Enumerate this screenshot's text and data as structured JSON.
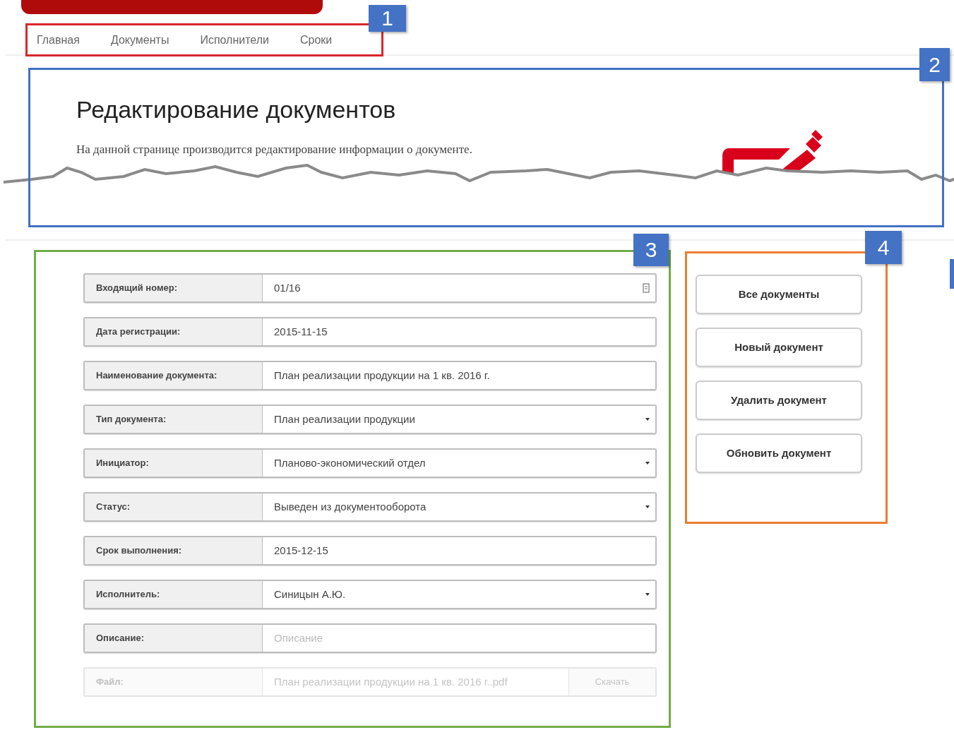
{
  "nav": {
    "badge": "1",
    "items": [
      {
        "label": "Главная"
      },
      {
        "label": "Документы"
      },
      {
        "label": "Исполнители"
      },
      {
        "label": "Сроки"
      }
    ]
  },
  "header": {
    "badge": "2",
    "title": "Редактирование документов",
    "description": "На данной странице производится редактирование информации о документе."
  },
  "form": {
    "badge": "3",
    "fields": [
      {
        "label": "Входящий номер:",
        "value": "01/16",
        "kind": "text",
        "icon": true,
        "disabled": false
      },
      {
        "label": "Дата регистрации:",
        "value": "2015-11-15",
        "kind": "text",
        "icon": false,
        "disabled": false
      },
      {
        "label": "Наименование документа:",
        "value": "План реализации продукции на 1 кв. 2016 г.",
        "kind": "text",
        "icon": false,
        "disabled": false
      },
      {
        "label": "Тип документа:",
        "value": "План реализации продукции",
        "kind": "select",
        "icon": false,
        "disabled": false
      },
      {
        "label": "Инициатор:",
        "value": "Планово-экономический отдел",
        "kind": "select",
        "icon": false,
        "disabled": false
      },
      {
        "label": "Статус:",
        "value": "Выведен из документооборота",
        "kind": "select",
        "icon": false,
        "disabled": false
      },
      {
        "label": "Срок выполнения:",
        "value": "2015-12-15",
        "kind": "text",
        "icon": false,
        "disabled": false
      },
      {
        "label": "Исполнитель:",
        "value": "Синицын А.Ю.",
        "kind": "select",
        "icon": false,
        "disabled": false
      },
      {
        "label": "Описание:",
        "placeholder": "Описание",
        "kind": "text",
        "icon": false,
        "disabled": false
      },
      {
        "label": "Файл:",
        "value": "План реализации продукции на 1 кв. 2016 г..pdf",
        "kind": "file",
        "button": "Скачать",
        "icon": false,
        "disabled": true
      }
    ]
  },
  "actions": {
    "badge": "4",
    "buttons": [
      {
        "label": "Все документы"
      },
      {
        "label": "Новый документ"
      },
      {
        "label": "Удалить документ"
      },
      {
        "label": "Обновить документ"
      }
    ]
  }
}
